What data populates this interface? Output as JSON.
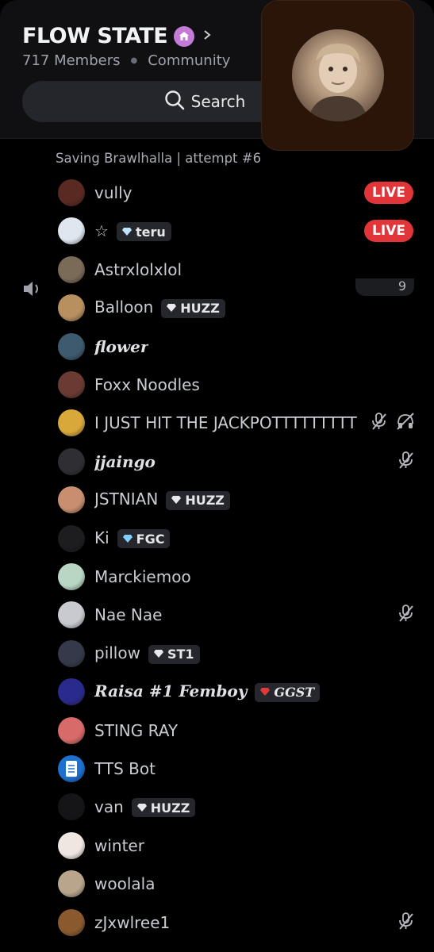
{
  "server": {
    "name": "FLOW STATE",
    "members_count": "717 Members",
    "type": "Community"
  },
  "search": {
    "label": "Search"
  },
  "channel": {
    "status": "Saving Brawlhalla | attempt #6",
    "count": "9"
  },
  "members": [
    {
      "name": "vully",
      "live": "LIVE",
      "avatar_color": "#5a2a22"
    },
    {
      "name": "☆",
      "tag": "teru",
      "tag_gem": "#bfe4ff",
      "live": "LIVE",
      "avatar_color": "#dfe6ef"
    },
    {
      "name": "Astrxlolxlol",
      "avatar_color": "#7a6a58"
    },
    {
      "name": "Balloon",
      "tag": "HUZZ",
      "tag_gem": "#e8e8ee",
      "avatar_color": "#b89060"
    },
    {
      "name": "flower",
      "bold": true,
      "avatar_color": "#3e5a6e"
    },
    {
      "name": "Foxx Noodles",
      "avatar_color": "#6b3a32"
    },
    {
      "name": "I JUST HIT THE JACKPOTTTTTTTTT",
      "mic_muted": true,
      "deafened": true,
      "avatar_color": "#d9a83a"
    },
    {
      "name": "jjaingo",
      "bold": true,
      "mic_muted": true,
      "avatar_color": "#2f2f33"
    },
    {
      "name": "JSTNIAN",
      "tag": "HUZZ",
      "tag_gem": "#e8e8ee",
      "avatar_color": "#c88e70"
    },
    {
      "name": "Ki",
      "tag": "FGC",
      "tag_gem": "#7fd0ff",
      "avatar_color": "#1d1d20"
    },
    {
      "name": "Marckiemoo",
      "avatar_color": "#b9d6c4"
    },
    {
      "name": "Nae Nae",
      "mic_muted": true,
      "avatar_color": "#c9cacf"
    },
    {
      "name": "pillow",
      "tag": "ST1",
      "tag_gem": "#e8e8ee",
      "avatar_color": "#35394a"
    },
    {
      "name": "Raisa #1 Femboy",
      "bold": true,
      "tag": "GGST",
      "tag_gem": "#e23a3a",
      "avatar_color": "#2a2a8c"
    },
    {
      "name": "STING RAY",
      "avatar_color": "#d86a6a"
    },
    {
      "name": "TTS Bot",
      "avatar_color": "#1d6fd0"
    },
    {
      "name": "van",
      "tag": "HUZZ",
      "tag_gem": "#e8e8ee",
      "avatar_color": "#151518"
    },
    {
      "name": "winter",
      "avatar_color": "#efe6e2"
    },
    {
      "name": "woolala",
      "avatar_color": "#b8a58c"
    },
    {
      "name": "zJxwlree1",
      "mic_muted": true,
      "avatar_color": "#8a5a2e"
    }
  ],
  "colors": {
    "live_red": "#e2353a",
    "background": "#000000",
    "header_bg": "#101013",
    "community_badge": "#c47bd8"
  },
  "icons": {
    "community": "house-badge-icon",
    "chevron": "chevron-right-icon",
    "search": "search-icon",
    "speaker": "speaker-icon",
    "mic_muted": "mic-muted-icon",
    "deafened": "headphones-muted-icon"
  }
}
